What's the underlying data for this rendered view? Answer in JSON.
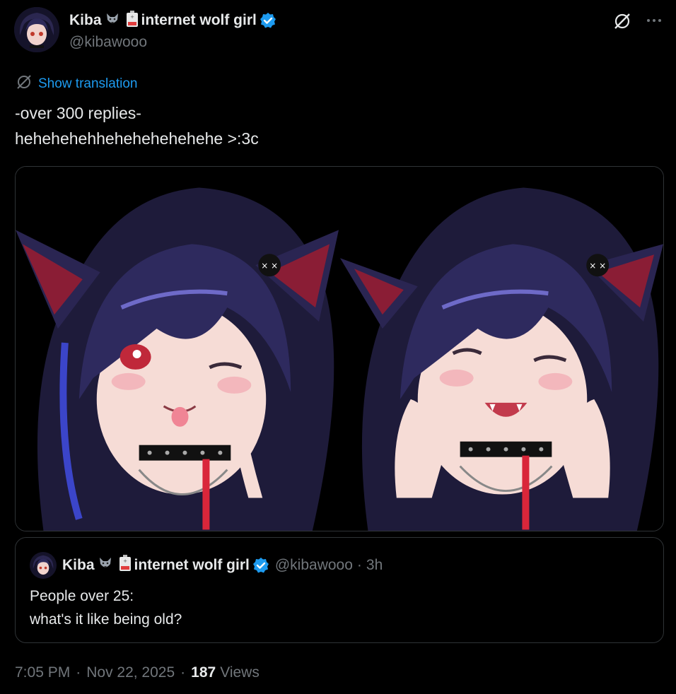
{
  "author": {
    "display_name": "Kiba",
    "name_suffix": "internet wolf girl",
    "handle": "@kibawooo",
    "verified": true,
    "emojis": [
      "wolf-face-emoji",
      "battery-low-emoji"
    ]
  },
  "translation": {
    "label": "Show translation"
  },
  "tweet": {
    "lines": [
      "-over 300 replies-",
      "hehehehehhehehehehehehe >:3c"
    ]
  },
  "media": {
    "count": 2,
    "items": [
      "anime-wolf-girl-wink-tongue",
      "anime-wolf-girl-laugh"
    ]
  },
  "quote": {
    "display_name": "Kiba",
    "name_suffix": "internet wolf girl",
    "handle": "@kibawooo",
    "separator": "·",
    "time": "3h",
    "lines": [
      "People over 25:",
      "what's it like being old?"
    ]
  },
  "meta": {
    "time": "7:05 PM",
    "separator": "·",
    "date": "Nov 22, 2025",
    "views_count": "187",
    "views_label": "Views"
  },
  "colors": {
    "background": "#000000",
    "text": "#e7e9ea",
    "muted": "#71767b",
    "accent": "#1d9bf0",
    "border": "#2f3336"
  }
}
